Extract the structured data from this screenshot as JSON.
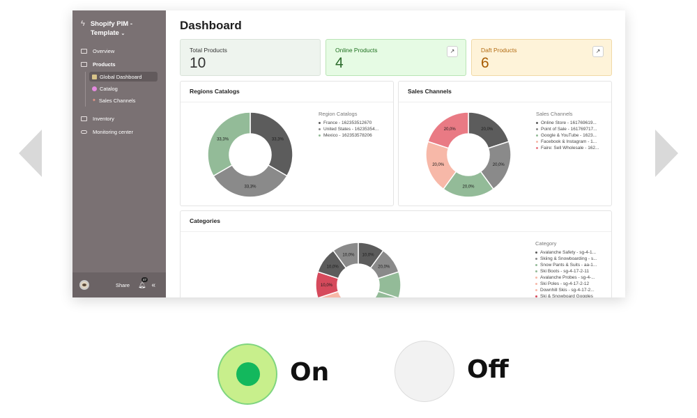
{
  "carousel": {
    "prev_icon": "triangle-left-icon",
    "next_icon": "triangle-right-icon"
  },
  "sidebar": {
    "brand": "Shopify PIM -",
    "brand_line2": "Template",
    "items": [
      {
        "label": "Overview"
      },
      {
        "label": "Products"
      },
      {
        "label": "Inventory"
      },
      {
        "label": "Monitoring center"
      }
    ],
    "sub_items": [
      {
        "label": "Global Dashboard"
      },
      {
        "label": "Catalog"
      },
      {
        "label": "Sales Channels"
      }
    ],
    "footer": {
      "share": "Share",
      "notification_count": "47"
    }
  },
  "page": {
    "title": "Dashboard"
  },
  "stats": [
    {
      "label": "Total Products",
      "value": "10"
    },
    {
      "label": "Online Products",
      "value": "4"
    },
    {
      "label": "Daft Products",
      "value": "6"
    }
  ],
  "regions_card": {
    "title": "Regions Catalogs"
  },
  "sales_card": {
    "title": "Sales Channels"
  },
  "categories_card": {
    "title": "Categories"
  },
  "chart_data": [
    {
      "type": "pie",
      "title": "Regions Catalogs",
      "legend_title": "Region Catalogs",
      "categories": [
        "France - 162353512670",
        "United States - 16235354...",
        "Mexico - 162353578206"
      ],
      "values": [
        33.3,
        33.3,
        33.3
      ],
      "labels": [
        "33,3%",
        "33,3%",
        "33,3%"
      ],
      "colors": [
        "#5c5c5c",
        "#8a8a8a",
        "#93bb98"
      ]
    },
    {
      "type": "pie",
      "title": "Sales Channels",
      "legend_title": "Sales Channels",
      "categories": [
        "Online Store - 161769619...",
        "Point of Sale - 161769717...",
        "Google & YouTube - 1623...",
        "Facebook & Instagram - 1...",
        "Faire: Sell Wholesale - 162..."
      ],
      "values": [
        20.0,
        20.0,
        20.0,
        20.0,
        20.0
      ],
      "labels": [
        "20,0%",
        "20,0%",
        "20,0%",
        "20,0%",
        "20,0%"
      ],
      "colors": [
        "#5c5c5c",
        "#8a8a8a",
        "#93bb98",
        "#f7b8a8",
        "#e97a84"
      ]
    },
    {
      "type": "pie",
      "title": "Categories",
      "legend_title": "Category",
      "categories": [
        "Avalanche Safety - sg-4-1...",
        "Skiing & Snowboarding - s...",
        "Snow Pants & Suits - aa-1...",
        "Ski Boots - sg-4-17-2-11",
        "Avalanche Probes - sg-4-...",
        "Ski Poles - sg-4-17-2-12",
        "Downhill Skis - sg-4-17-2...",
        "Ski & Snowboard Goggles"
      ],
      "values": [
        10.0,
        10.0,
        10.0,
        10.0,
        10.0,
        10.0,
        10.0,
        10.0,
        10.0,
        10.0
      ],
      "labels": [
        "10,0%",
        "20,0%",
        "",
        "",
        "",
        "",
        "10,0%",
        "10,0%",
        "10,0%",
        "10,0%"
      ],
      "colors": [
        "#5c5c5c",
        "#8a8a8a",
        "#93bb98",
        "#93bb98",
        "#f7b8a8",
        "#f7b8a8",
        "#f7b8a8",
        "#d64a5c",
        "#5c5c5c",
        "#8a8a8a"
      ]
    }
  ],
  "toggles": [
    {
      "label": "On",
      "state": "on",
      "color": "#13b85d"
    },
    {
      "label": "Off",
      "state": "off"
    }
  ]
}
